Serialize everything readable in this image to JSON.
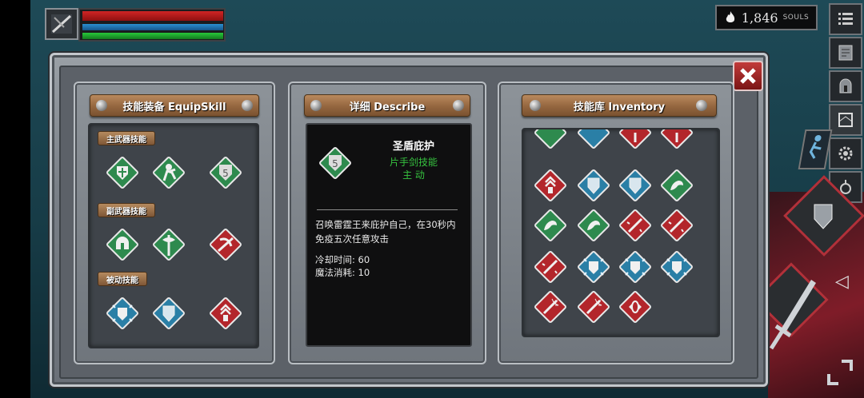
{
  "hud": {
    "hp_fill": 1.0,
    "mana_fill": 1.0,
    "stamina_fill": 1.0,
    "souls_value": "1,846",
    "souls_label": "SOULS",
    "souls_icon": "flame-icon"
  },
  "right_menu": [
    "menu-list-icon",
    "map-icon",
    "helmet-icon",
    "scroll-icon",
    "gear-icon",
    "ring-icon"
  ],
  "panels": {
    "equip": {
      "title": "技能装备 EquipSkill",
      "main_weapon_label": "主武器技能",
      "off_weapon_label": "副武器技能",
      "passive_label": "被动技能"
    },
    "describe": {
      "title": "详细 Describe",
      "skill_name": "圣盾庇护",
      "skill_type": "片手剑技能",
      "skill_mode": "主 动",
      "description": "召唤雷霆王来庇护自己，在30秒内免疫五次任意攻击",
      "cooldown": "冷却时间: 60",
      "mana_cost": "魔法消耗: 10"
    },
    "inventory": {
      "title": "技能库 Inventory"
    }
  },
  "colors": {
    "green": "#2e8a4e",
    "blue": "#2a7fa6",
    "red": "#b3262b",
    "accent_green_text": "#36c23f"
  }
}
